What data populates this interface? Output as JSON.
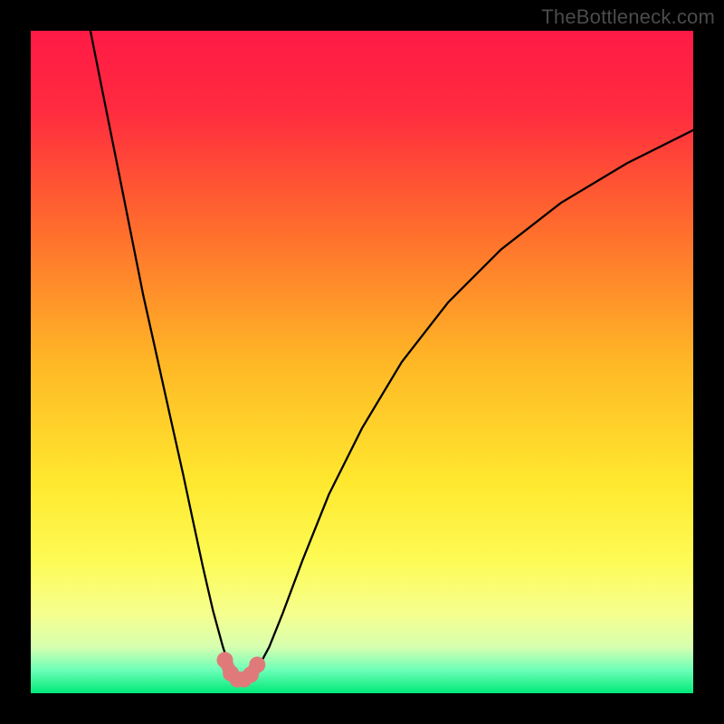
{
  "watermark": "TheBottleneck.com",
  "chart_data": {
    "type": "line",
    "title": "",
    "xlabel": "",
    "ylabel": "",
    "xlim": [
      0,
      100
    ],
    "ylim": [
      0,
      100
    ],
    "grid": false,
    "legend": false,
    "gradient_stops": [
      {
        "pos": 0.0,
        "color": "#ff1a46"
      },
      {
        "pos": 0.12,
        "color": "#ff2b3f"
      },
      {
        "pos": 0.3,
        "color": "#ff6d2d"
      },
      {
        "pos": 0.5,
        "color": "#ffb726"
      },
      {
        "pos": 0.68,
        "color": "#ffe82e"
      },
      {
        "pos": 0.8,
        "color": "#fdfb55"
      },
      {
        "pos": 0.88,
        "color": "#f6ff8e"
      },
      {
        "pos": 0.93,
        "color": "#d7ffb0"
      },
      {
        "pos": 0.965,
        "color": "#6dffb8"
      },
      {
        "pos": 1.0,
        "color": "#00e978"
      }
    ],
    "series": [
      {
        "name": "bottleneck-curve",
        "stroke": "#000000",
        "stroke_width": 2.3,
        "x": [
          9,
          11,
          13,
          15,
          17,
          19,
          21,
          23,
          24.5,
          26,
          27.5,
          29,
          30,
          31,
          32,
          33,
          34.5,
          36,
          38,
          41,
          45,
          50,
          56,
          63,
          71,
          80,
          90,
          100
        ],
        "values": [
          100,
          90,
          80,
          70,
          60,
          51,
          42,
          33,
          26,
          19,
          12.5,
          7,
          4,
          2.3,
          2.1,
          2.4,
          4.2,
          7,
          12,
          20,
          30,
          40,
          50,
          59,
          67,
          74,
          80,
          85
        ]
      },
      {
        "name": "highlight-dots",
        "stroke": "#e07a7a",
        "type_hint": "marker",
        "marker_radius": 9,
        "x": [
          29.3,
          30.2,
          31.2,
          32.2,
          33.2,
          34.2
        ],
        "values": [
          5.0,
          3.0,
          2.1,
          2.1,
          2.8,
          4.3
        ]
      }
    ]
  }
}
